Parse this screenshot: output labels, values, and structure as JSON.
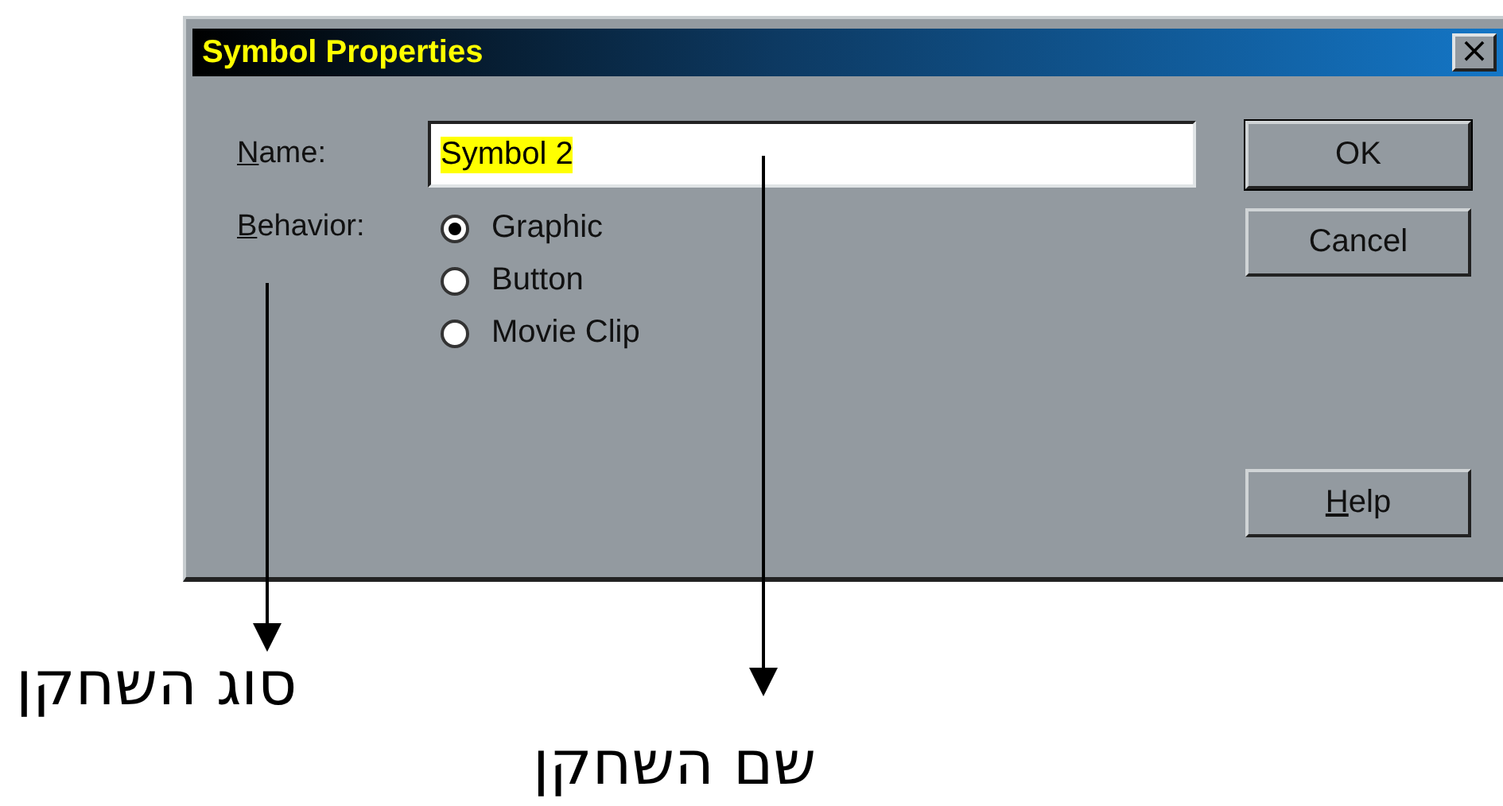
{
  "window": {
    "title": "Symbol Properties",
    "close": "×"
  },
  "name_field": {
    "label": "Name:",
    "value": "Symbol 2",
    "text_selected": true
  },
  "behavior": {
    "label": "Behavior:",
    "options": [
      {
        "label": "Graphic",
        "selected": true
      },
      {
        "label": "Button",
        "selected": false
      },
      {
        "label": "Movie Clip",
        "selected": false
      }
    ]
  },
  "buttons": [
    {
      "label": "OK",
      "default": true
    },
    {
      "label": "Cancel",
      "default": false
    },
    {
      "label": "Help",
      "default": false
    }
  ],
  "annotations": [
    {
      "text": "סוג השחקן"
    },
    {
      "text": "שם השחקן"
    }
  ]
}
